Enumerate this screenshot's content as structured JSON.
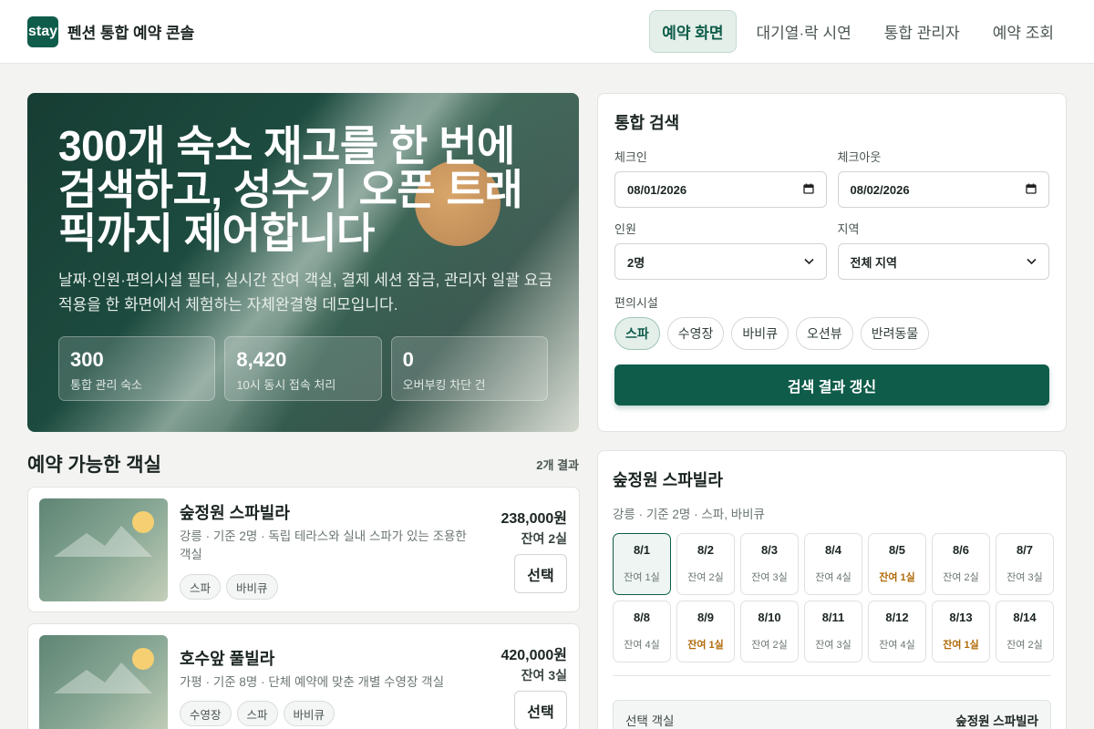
{
  "header": {
    "logo_text": "stay",
    "brand": "펜션 통합 예약 콘솔",
    "nav": [
      {
        "label": "예약 화면",
        "active": true
      },
      {
        "label": "대기열·락 시연",
        "active": false
      },
      {
        "label": "통합 관리자",
        "active": false
      },
      {
        "label": "예약 조회",
        "active": false
      }
    ]
  },
  "hero": {
    "title": "300개 숙소 재고를 한 번에 검색하고, 성수기 오픈 트래픽까지 제어합니다",
    "description": "날짜·인원·편의시설 필터, 실시간 잔여 객실, 결제 세션 잠금, 관리자 일괄 요금 적용을 한 화면에서 체험하는 자체완결형 데모입니다.",
    "stats": [
      {
        "value": "300",
        "label": "통합 관리 숙소"
      },
      {
        "value": "8,420",
        "label": "10시 동시 접속 처리"
      },
      {
        "value": "0",
        "label": "오버부킹 차단 건"
      }
    ]
  },
  "search": {
    "title": "통합 검색",
    "checkin_label": "체크인",
    "checkin_value": "08/01/2026",
    "checkout_label": "체크아웃",
    "checkout_value": "08/02/2026",
    "guests_label": "인원",
    "guests_value": "2명",
    "region_label": "지역",
    "region_value": "전체 지역",
    "amenities_label": "편의시설",
    "amenities": [
      {
        "label": "스파",
        "active": true
      },
      {
        "label": "수영장",
        "active": false
      },
      {
        "label": "바비큐",
        "active": false
      },
      {
        "label": "오션뷰",
        "active": false
      },
      {
        "label": "반려동물",
        "active": false
      }
    ],
    "submit_label": "검색 결과 갱신"
  },
  "results": {
    "title": "예약 가능한 객실",
    "count": "2개 결과",
    "items": [
      {
        "name": "숲정원 스파빌라",
        "description": "강릉 · 기준 2명 · 독립 테라스와 실내 스파가 있는 조용한 객실",
        "tags": [
          "스파",
          "바비큐"
        ],
        "price": "238,000원",
        "remaining": "잔여 2실",
        "select_label": "선택"
      },
      {
        "name": "호수앞 풀빌라",
        "description": "가평 · 기준 8명 · 단체 예약에 맞춘 개별 수영장 객실",
        "tags": [
          "수영장",
          "스파",
          "바비큐"
        ],
        "price": "420,000원",
        "remaining": "잔여 3실",
        "select_label": "선택"
      }
    ]
  },
  "detail": {
    "name": "숲정원 스파빌라",
    "meta": "강릉 · 기준 2명 · 스파, 바비큐",
    "calendar": [
      {
        "date": "8/1",
        "left": "잔여 1실",
        "low": false,
        "active": true
      },
      {
        "date": "8/2",
        "left": "잔여 2실",
        "low": false,
        "active": false
      },
      {
        "date": "8/3",
        "left": "잔여 3실",
        "low": false,
        "active": false
      },
      {
        "date": "8/4",
        "left": "잔여 4실",
        "low": false,
        "active": false
      },
      {
        "date": "8/5",
        "left": "잔여 1실",
        "low": true,
        "active": false
      },
      {
        "date": "8/6",
        "left": "잔여 2실",
        "low": false,
        "active": false
      },
      {
        "date": "8/7",
        "left": "잔여 3실",
        "low": false,
        "active": false
      },
      {
        "date": "8/8",
        "left": "잔여 4실",
        "low": false,
        "active": false
      },
      {
        "date": "8/9",
        "left": "잔여 1실",
        "low": true,
        "active": false
      },
      {
        "date": "8/10",
        "left": "잔여 2실",
        "low": false,
        "active": false
      },
      {
        "date": "8/11",
        "left": "잔여 3실",
        "low": false,
        "active": false
      },
      {
        "date": "8/12",
        "left": "잔여 4실",
        "low": false,
        "active": false
      },
      {
        "date": "8/13",
        "left": "잔여 1실",
        "low": true,
        "active": false
      },
      {
        "date": "8/14",
        "left": "잔여 2실",
        "low": false,
        "active": false
      }
    ],
    "selected_label": "선택 객실",
    "selected_value": "숲정원 스파빌라"
  },
  "colors": {
    "primary": "#0f5c4a",
    "primary_soft": "#e4efea",
    "low_stock": "#b06a08"
  }
}
